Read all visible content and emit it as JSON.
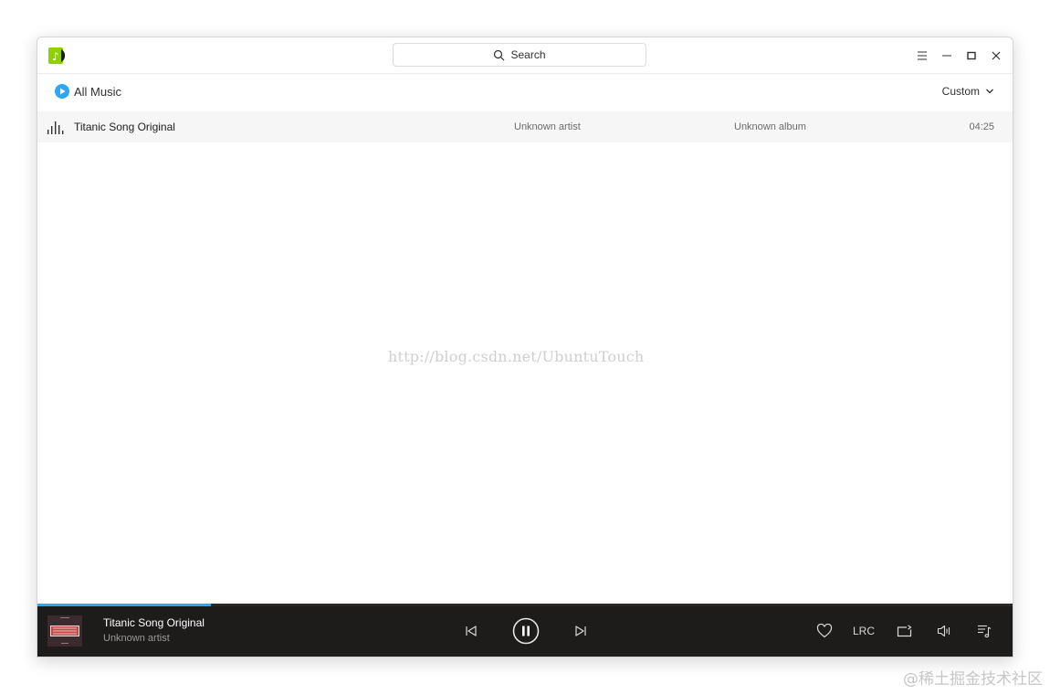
{
  "titlebar": {
    "search_label": "Search",
    "icons": [
      "app-logo",
      "search-icon",
      "menu-icon",
      "minimize-icon",
      "maximize-icon",
      "close-icon"
    ]
  },
  "header": {
    "all_music_label": "All Music",
    "sort_label": "Custom"
  },
  "songs": [
    {
      "title": "Titanic Song Original",
      "artist": "Unknown artist",
      "album": "Unknown album",
      "duration": "04:25",
      "playing": true
    }
  ],
  "watermark_center": "http://blog.csdn.net/UbuntuTouch",
  "player": {
    "title": "Titanic Song Original",
    "artist": "Unknown artist",
    "progress": 0.178,
    "lyrics_label": "LRC",
    "state": "playing"
  },
  "page_watermark": "@稀土掘金技术社区",
  "colors": {
    "accent": "#2ca7f8",
    "player_bg": "#1e1b1b",
    "row_highlight": "#f6f6f6"
  }
}
